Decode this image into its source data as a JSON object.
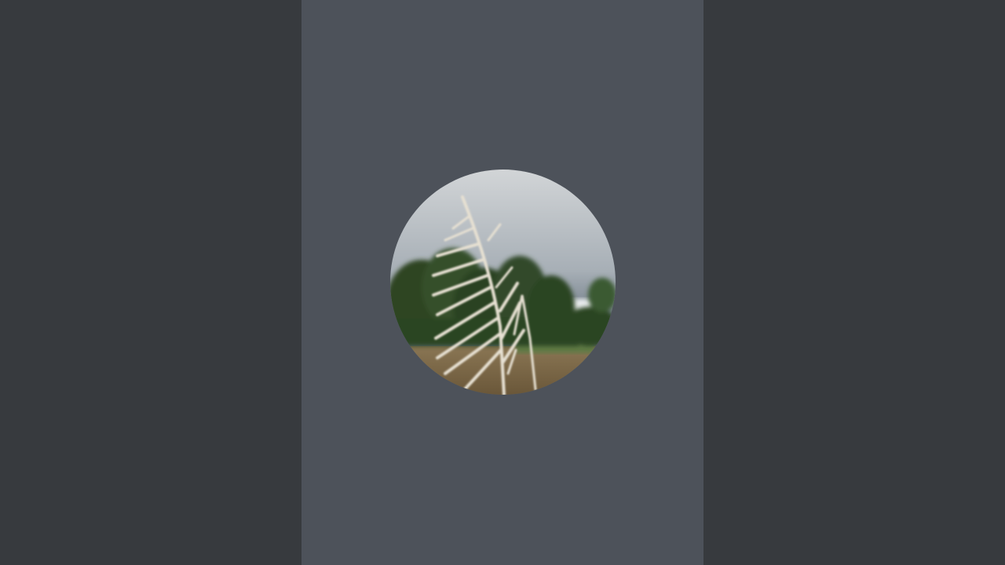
{
  "screen": {
    "background_color": "#373a3e",
    "center_column_color": "#4d525a"
  },
  "profile_photo": {
    "shape": "circle",
    "subject": "grass-plume-over-trees-photo",
    "colors": {
      "sky_top": "#c9ccce",
      "sky_bottom": "#5f6c78",
      "trees": "#2f4a26",
      "ground": "#7d6a48",
      "plume": "#e8e2d4"
    }
  }
}
